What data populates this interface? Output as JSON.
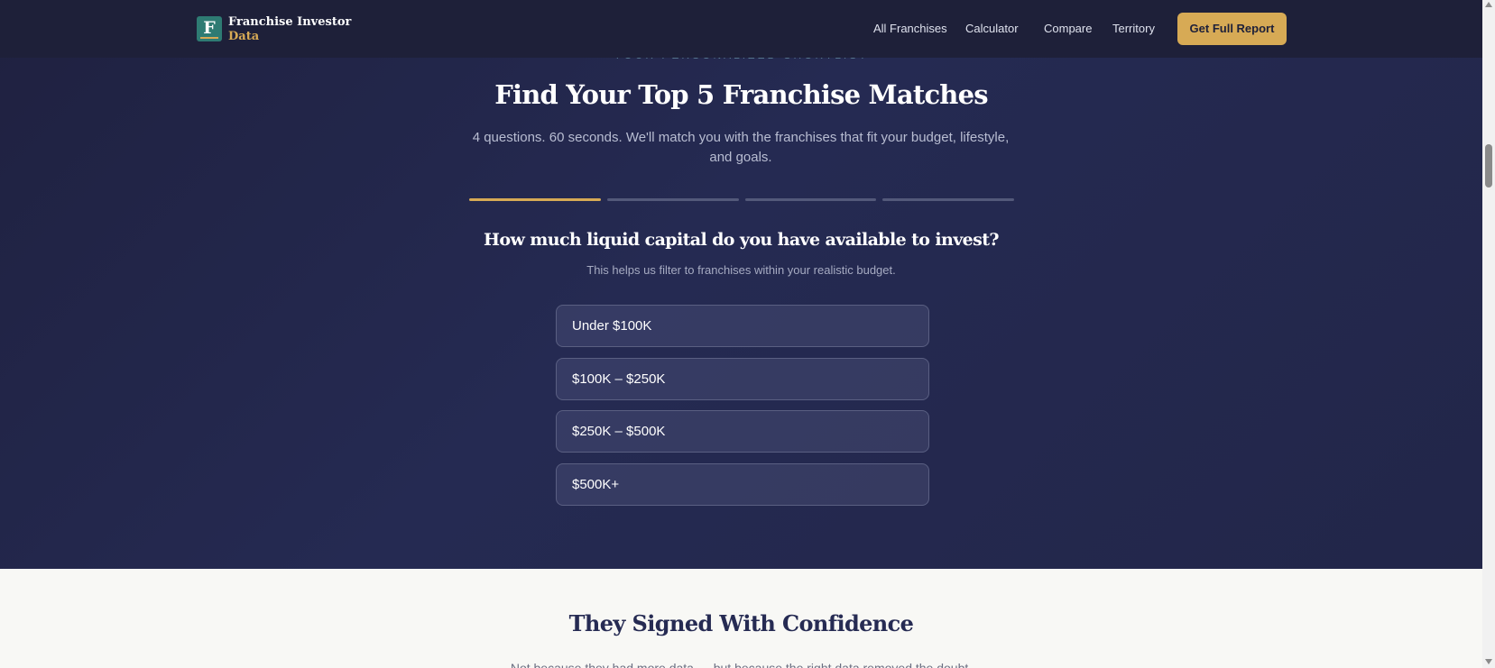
{
  "header": {
    "logo_letter": "F",
    "logo_line1": "Franchise Investor",
    "logo_line2": "Data",
    "nav": [
      "All Franchises",
      "Calculator",
      "Compare",
      "Territory"
    ],
    "cta_label": "Get Full Report"
  },
  "hero": {
    "eyebrow": "YOUR PERSONALIZED SHORTLIST",
    "title": "Find Your Top 5 Franchise Matches",
    "subtitle": "4 questions. 60 seconds. We'll match you with the franchises that fit your budget, lifestyle, and goals.",
    "progress": {
      "current_step": 1,
      "total_steps": 4
    }
  },
  "quiz": {
    "question": "How much liquid capital do you have available to invest?",
    "help": "This helps us filter to franchises within your realistic budget.",
    "options": [
      "Under $100K",
      "$100K – $250K",
      "$250K – $500K",
      "$500K+"
    ]
  },
  "testimonials": {
    "title": "They Signed With Confidence",
    "subtitle": "Not because they had more data — but because the right data removed the doubt."
  },
  "colors": {
    "hero_bg": "#232649",
    "header_bg": "#1e2039",
    "accent_gold": "#d7aa55",
    "logo_teal": "#2e7b73"
  }
}
